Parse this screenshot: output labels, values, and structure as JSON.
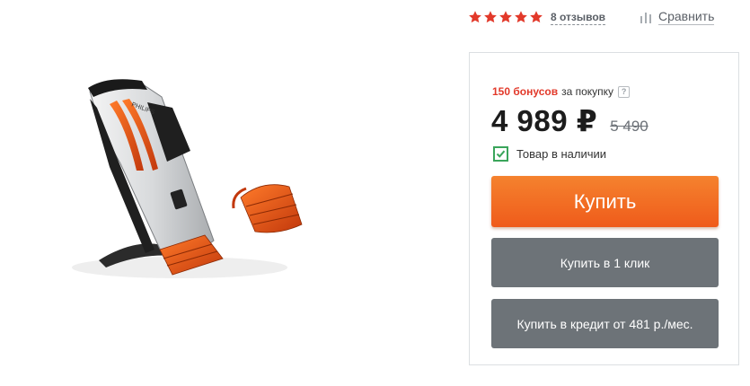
{
  "rating": {
    "stars": 5,
    "star_color": "#e2392a",
    "reviews_label": "8 отзывов"
  },
  "compare": {
    "label": "Сравнить",
    "icon": "bar-chart-icon"
  },
  "product": {
    "image": "philips-styleshaver-trimmer",
    "brand_on_device": "PHILIPS"
  },
  "offer": {
    "bonus_amount": "150 бонусов",
    "bonus_suffix": "за покупку",
    "bonus_help": "?",
    "price": "4 989 ₽",
    "old_price": "5 490",
    "stock_label": "Товар в наличии",
    "stock_color": "#3aa55b"
  },
  "buttons": {
    "buy_label": "Купить",
    "buy_color": "#f26c22",
    "oneclick_label": "Купить в 1 клик",
    "credit_label": "Купить в кредит от 481 р./мес.",
    "secondary_color": "#6d7378"
  }
}
